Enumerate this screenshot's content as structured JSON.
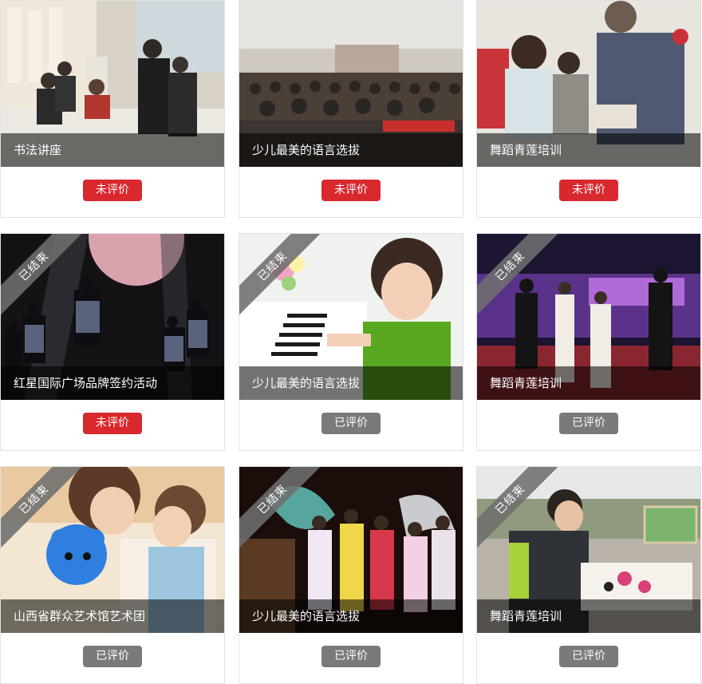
{
  "status_colors": {
    "pending": "#d9282e",
    "done": "#7a7a7a",
    "ribbon": "#6e6e6e"
  },
  "cards": [
    {
      "title": "书法讲座",
      "button": "未评价",
      "button_state": "pending",
      "ribbon": null,
      "image": "calligraphy-lecture-photo-icon"
    },
    {
      "title": "少儿最美的语言选拔",
      "button": "未评价",
      "button_state": "pending",
      "ribbon": null,
      "image": "auditorium-audience-photo-icon"
    },
    {
      "title": "舞蹈青莲培训",
      "button": "未评价",
      "button_state": "pending",
      "ribbon": null,
      "image": "workshop-group-photo-icon"
    },
    {
      "title": "红星国际广场品牌签约活动",
      "button": "未评价",
      "button_state": "pending",
      "ribbon": "已结束",
      "image": "stage-dancers-photo-icon"
    },
    {
      "title": "少儿最美的语言选拔",
      "button": "已评价",
      "button_state": "done",
      "ribbon": "已结束",
      "image": "girl-piano-photo-icon"
    },
    {
      "title": "舞蹈青莲培训",
      "button": "已评价",
      "button_state": "done",
      "ribbon": "已结束",
      "image": "stage-singers-photo-icon"
    },
    {
      "title": "山西省群众艺术馆艺术团",
      "button": "已评价",
      "button_state": "done",
      "ribbon": "已结束",
      "image": "mother-child-toy-photo-icon"
    },
    {
      "title": "少儿最美的语言选拔",
      "button": "已评价",
      "button_state": "done",
      "ribbon": "已结束",
      "image": "folk-dance-photo-icon"
    },
    {
      "title": "舞蹈青莲培训",
      "button": "已评价",
      "button_state": "done",
      "ribbon": "已结束",
      "image": "outdoor-painting-photo-icon"
    }
  ]
}
